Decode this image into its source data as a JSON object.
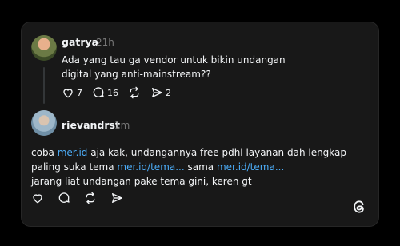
{
  "post": {
    "username": "gatrya",
    "time": "21h",
    "text": "Ada yang tau ga vendor untuk bikin undangan digital yang anti-mainstream??",
    "likes": "7",
    "comments": "16",
    "shares": "2"
  },
  "reply": {
    "username": "rievandrst",
    "time": "1m",
    "line1_pre": "coba ",
    "line1_link": "mer.id",
    "line1_post": " aja kak, undangannya free pdhl layanan dah lengkap",
    "line2_pre": "paling suka tema ",
    "line2_link1": "mer.id/tema...",
    "line2_mid": " sama ",
    "line2_link2": "mer.id/tema...",
    "line3": "jarang liat undangan pake tema gini, keren gt"
  },
  "icons": {
    "like": "heart-icon",
    "comment": "comment-icon",
    "repost": "repost-icon",
    "share": "share-icon",
    "logo": "threads-logo-icon"
  },
  "colors": {
    "background": "#000000",
    "card": "#181818",
    "text": "#f3f5f7",
    "muted": "#777777",
    "link": "#4cadf8"
  }
}
